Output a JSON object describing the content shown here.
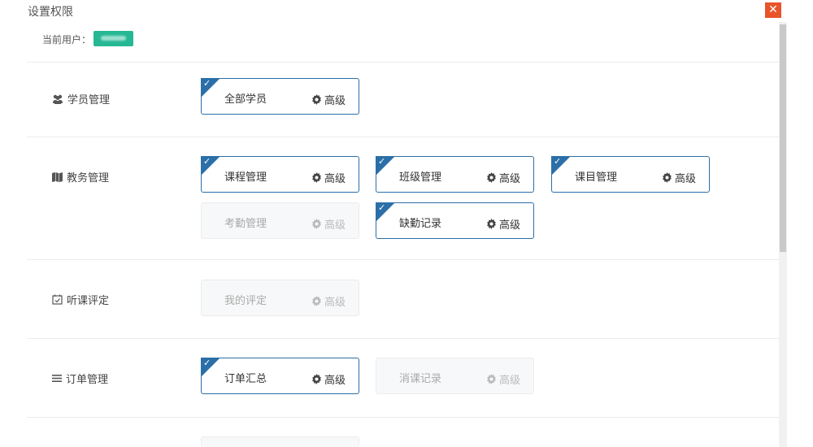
{
  "dialog": {
    "title": "设置权限",
    "close": "✕"
  },
  "user": {
    "label": "当前用户："
  },
  "sections": {
    "students": {
      "label": "学员管理",
      "cards": [
        {
          "name": "全部学员",
          "adv": "高级",
          "checked": true
        }
      ]
    },
    "academic": {
      "label": "教务管理",
      "cards": [
        {
          "name": "课程管理",
          "adv": "高级",
          "checked": true
        },
        {
          "name": "班级管理",
          "adv": "高级",
          "checked": true
        },
        {
          "name": "课目管理",
          "adv": "高级",
          "checked": true
        },
        {
          "name": "考勤管理",
          "adv": "高级",
          "checked": false
        },
        {
          "name": "缺勤记录",
          "adv": "高级",
          "checked": true
        }
      ]
    },
    "evaluation": {
      "label": "听课评定",
      "cards": [
        {
          "name": "我的评定",
          "adv": "高级",
          "checked": false
        }
      ]
    },
    "orders": {
      "label": "订单管理",
      "cards": [
        {
          "name": "订单汇总",
          "adv": "高级",
          "checked": true
        },
        {
          "name": "消课记录",
          "adv": "高级",
          "checked": false
        }
      ]
    }
  },
  "colors": {
    "accent": "#2b6fa8",
    "close_bg": "#e8542a",
    "badge": "#26b894"
  }
}
